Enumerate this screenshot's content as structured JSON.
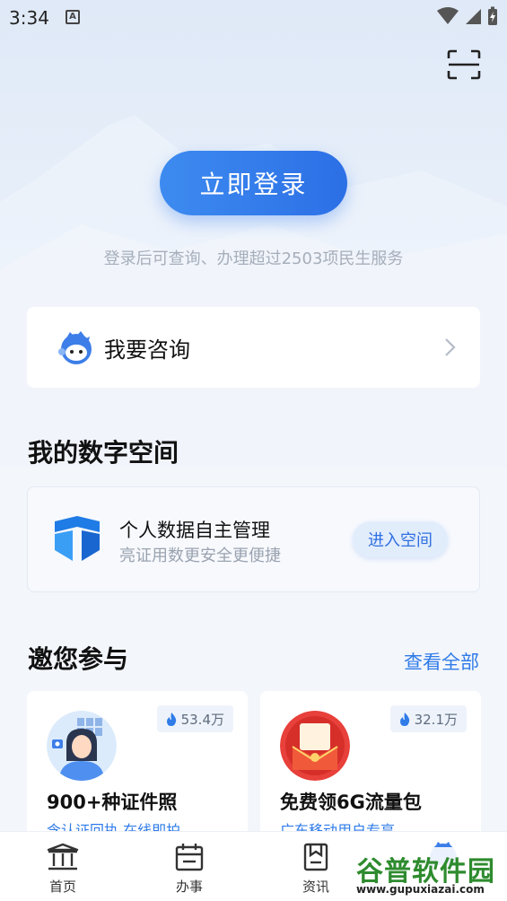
{
  "status_bar": {
    "time": "3:34",
    "notification_icon": "A"
  },
  "header": {
    "scan_icon": "scan-icon"
  },
  "login": {
    "button_label": "立即登录",
    "hint": "登录后可查询、办理超过2503项民生服务"
  },
  "consult": {
    "label": "我要咨询"
  },
  "digital_space": {
    "heading": "我的数字空间",
    "title": "个人数据自主管理",
    "subtitle": "亮证用数更安全更便捷",
    "button_label": "进入空间"
  },
  "participate": {
    "heading": "邀您参与",
    "see_all": "查看全部",
    "cards": [
      {
        "badge": "53.4万",
        "title": "900+种证件照",
        "subtitle": "含认证回执 在线即拍"
      },
      {
        "badge": "32.1万",
        "title": "免费领6G流量包",
        "subtitle": "广东移动用户专享"
      }
    ]
  },
  "tabbar": {
    "items": [
      {
        "label": "首页"
      },
      {
        "label": "办事"
      },
      {
        "label": "资讯"
      }
    ]
  },
  "watermark": {
    "logo": "谷普软件园",
    "url": "www.gupuxiazai.com"
  },
  "colors": {
    "accent": "#2f7be8",
    "login_button": "#3d8bf0"
  }
}
